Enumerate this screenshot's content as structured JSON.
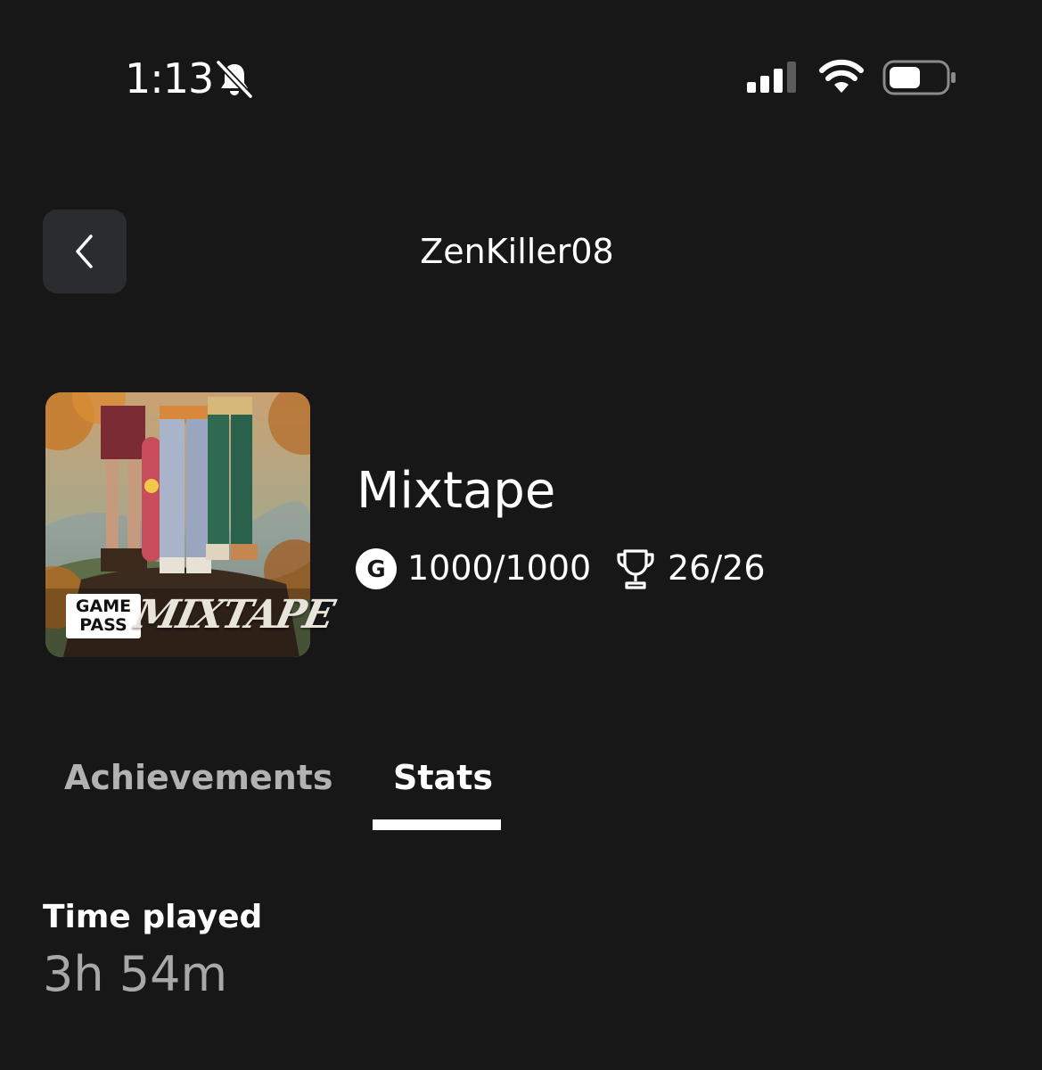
{
  "status_bar": {
    "time": "1:13",
    "icons": [
      "bell-slash-icon",
      "cellular-signal-icon",
      "wifi-icon",
      "battery-icon"
    ]
  },
  "header": {
    "back_icon": "chevron-left-icon",
    "title": "ZenKiller08"
  },
  "game": {
    "title": "Mixtape",
    "cover_badge_line1": "GAME",
    "cover_badge_line2": "PASS",
    "cover_logo_text": "MIXTAPE",
    "gamerscore_icon_letter": "G",
    "gamerscore": "1000/1000",
    "achievements_count": "26/26"
  },
  "tabs": [
    {
      "label": "Achievements",
      "selected": false
    },
    {
      "label": "Stats",
      "selected": true
    }
  ],
  "stats": {
    "time_played_label": "Time played",
    "time_played_value": "3h 54m"
  },
  "colors": {
    "background": "#171717",
    "back_button_bg": "#2b2c2f",
    "text_primary": "#ffffff",
    "text_inactive_tab": "#b2b2b2",
    "text_secondary": "#a8a8a8"
  }
}
